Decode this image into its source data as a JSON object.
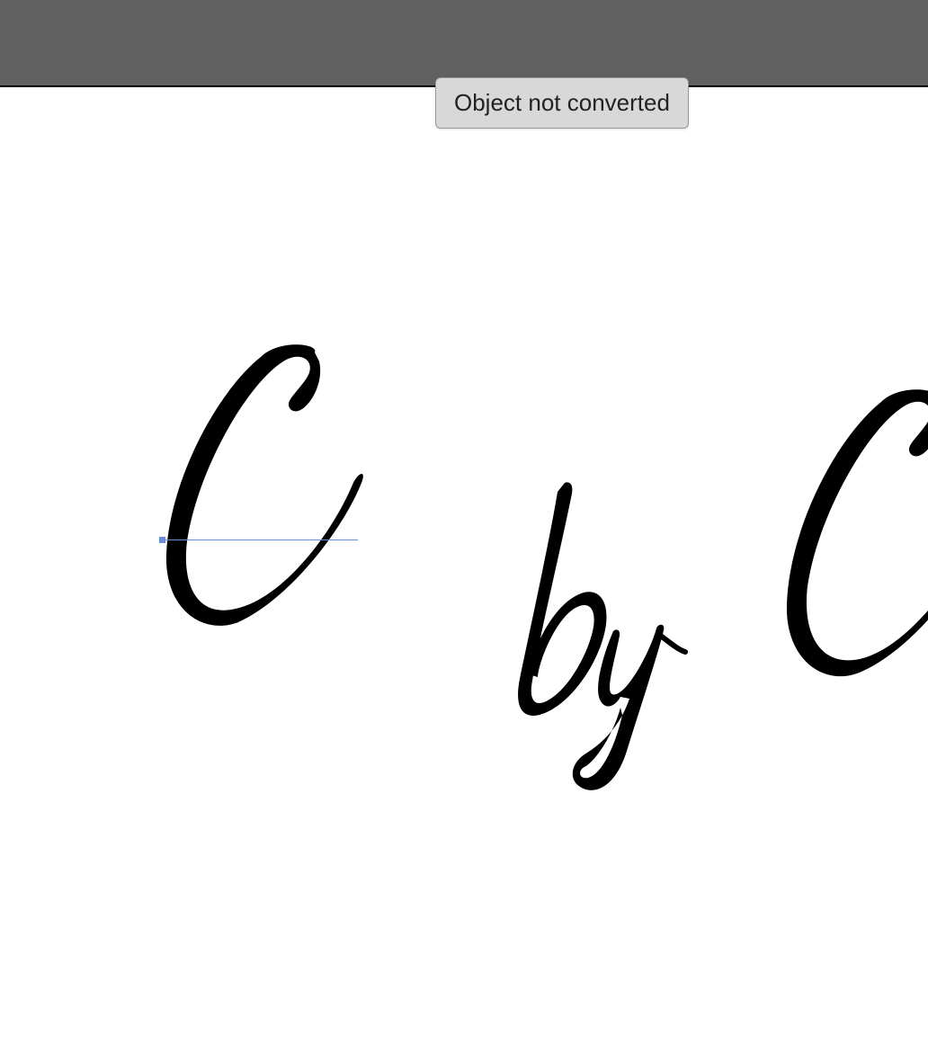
{
  "tooltip": {
    "text": "Object not converted"
  },
  "canvas": {
    "glyphs": {
      "c1": "C",
      "by": "by",
      "c2": "C"
    }
  },
  "selection": {
    "line_color": "#6a8fd8"
  }
}
